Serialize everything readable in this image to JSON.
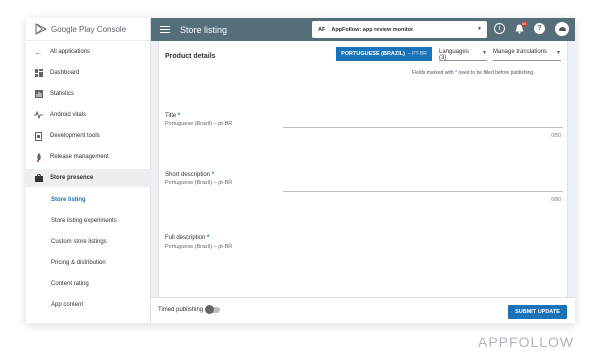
{
  "app": {
    "brand": "Google Play Console",
    "header_title": "Store listing",
    "app_selector": {
      "initials": "AF",
      "name": "AppFollow: app review monitor"
    },
    "notification_count": "58"
  },
  "sidebar": {
    "back": "All applications",
    "items": [
      {
        "label": "Dashboard",
        "icon": "dashboard-icon"
      },
      {
        "label": "Statistics",
        "icon": "statistics-icon"
      },
      {
        "label": "Android vitals",
        "icon": "vitals-icon"
      },
      {
        "label": "Development tools",
        "icon": "devtools-icon"
      },
      {
        "label": "Release management",
        "icon": "rocket-icon"
      },
      {
        "label": "Store presence",
        "icon": "store-icon"
      }
    ],
    "subitems": [
      {
        "label": "Store listing"
      },
      {
        "label": "Store listing experiments"
      },
      {
        "label": "Custom store listings"
      },
      {
        "label": "Pricing & distribution"
      },
      {
        "label": "Content rating"
      },
      {
        "label": "App content"
      }
    ]
  },
  "main": {
    "section_title": "Product details",
    "language_button": {
      "label": "PORTUGUESE (BRAZIL)",
      "code": "– PT-BR"
    },
    "languages_dropdown": "Languages (3)",
    "manage_dropdown": "Manage translations",
    "required_note_pre": "Fields marked with",
    "required_note_star": "*",
    "required_note_post": "need to be filled before publishing.",
    "fields": [
      {
        "label": "Title",
        "locale": "Portuguese (Brazil) – pt-BR",
        "counter": "0/50"
      },
      {
        "label": "Short description",
        "locale": "Portuguese (Brazil) – pt-BR",
        "counter": "0/80"
      },
      {
        "label": "Full description",
        "locale": "Portuguese (Brazil) – pt-BR"
      }
    ]
  },
  "bottom": {
    "timed_publishing": "Timed publishing",
    "submit": "SUBMIT UPDATE"
  },
  "watermark": "APPFOLLOW",
  "colors": {
    "accent": "#1a73b8",
    "topbar": "#546e7a",
    "badge": "#d32f2f"
  }
}
